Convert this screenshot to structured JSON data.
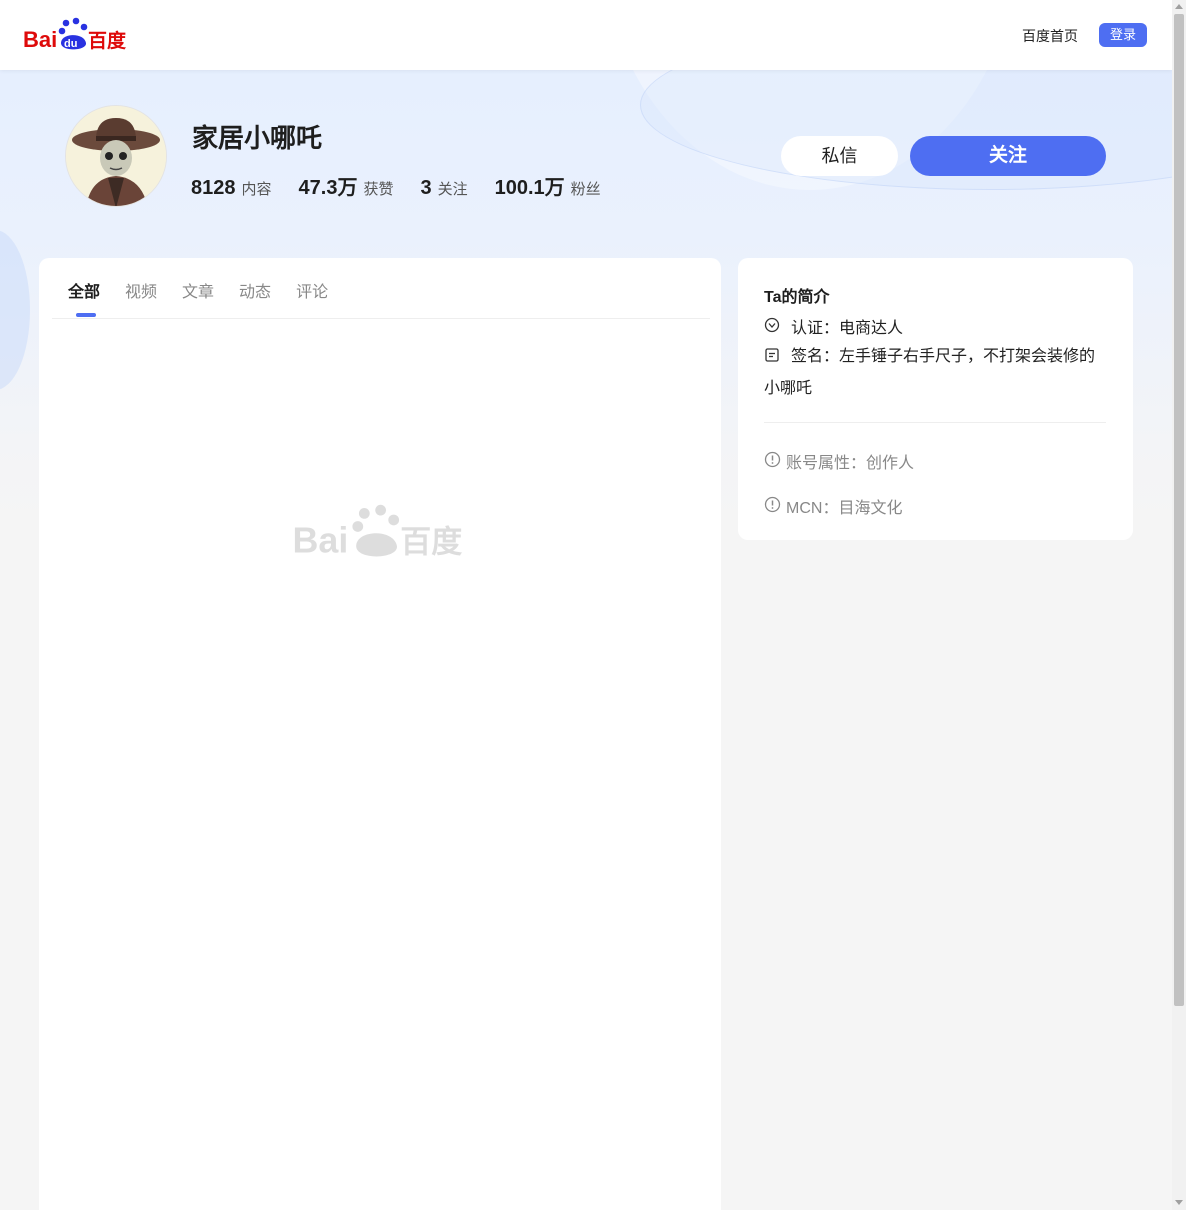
{
  "header": {
    "logo_text": "Bai百度",
    "home_link": "百度首页",
    "login_label": "登录"
  },
  "profile": {
    "name": "家居小哪吒",
    "stats": [
      {
        "value": "8128",
        "label": "内容"
      },
      {
        "value": "47.3万",
        "label": "获赞"
      },
      {
        "value": "3",
        "label": "关注"
      },
      {
        "value": "100.1万",
        "label": "粉丝"
      }
    ],
    "message_button": "私信",
    "follow_button": "关注"
  },
  "tabs": [
    {
      "label": "全部",
      "active": true
    },
    {
      "label": "视频",
      "active": false
    },
    {
      "label": "文章",
      "active": false
    },
    {
      "label": "动态",
      "active": false
    },
    {
      "label": "评论",
      "active": false
    }
  ],
  "intro": {
    "title": "Ta的简介",
    "certification": "认证：电商达人",
    "signature": "签名：左手锤子右手尺子，不打架会装修的小哪吒",
    "account_type": "账号属性：创作人",
    "mcn": "MCN：目海文化"
  },
  "colors": {
    "accent": "#4e6ef2",
    "logo_red": "#de0a0a",
    "logo_blue": "#2932e1"
  }
}
